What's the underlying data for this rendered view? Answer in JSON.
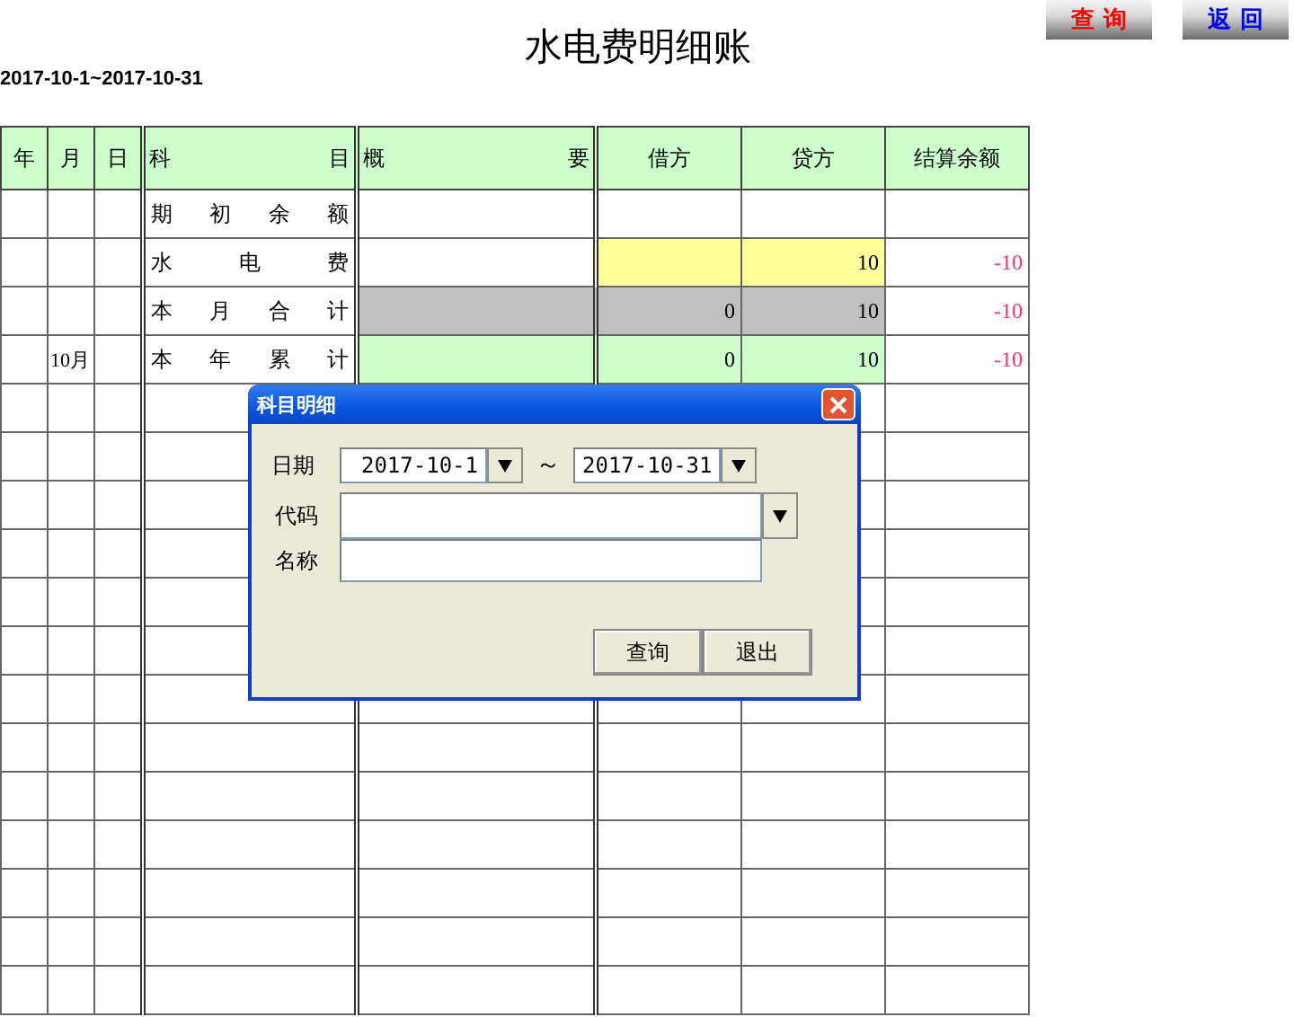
{
  "title": "水电费明细账",
  "period": "2017-10-1~2017-10-31",
  "top_buttons": [
    {
      "label": "查 询",
      "kind": "query"
    },
    {
      "label": "返 回",
      "kind": "back"
    }
  ],
  "table": {
    "columns": [
      "年",
      "月",
      "日",
      "科 目",
      "概 要",
      "借方",
      "贷方",
      "结算余额"
    ],
    "rows": [
      {
        "kind": "opening",
        "year": "",
        "month": "",
        "day": "",
        "subject": "期 初 余 额",
        "summary": "",
        "debit": "",
        "credit": "",
        "balance": ""
      },
      {
        "kind": "item",
        "year": "",
        "month": "",
        "day": "",
        "subject": "水 电 费",
        "summary": "",
        "debit": "",
        "credit": "10",
        "balance": "-10"
      },
      {
        "kind": "month_total",
        "year": "",
        "month": "",
        "day": "",
        "subject": "本 月 合 计",
        "summary": "",
        "debit": "0",
        "credit": "10",
        "balance": "-10"
      },
      {
        "kind": "year_total",
        "year": "",
        "month": "10月",
        "day": "",
        "subject": "本 年 累 计",
        "summary": "",
        "debit": "0",
        "credit": "10",
        "balance": "-10"
      }
    ]
  },
  "dialog": {
    "title": "科目明细",
    "date_label": "日期",
    "date_from": "2017-10-1",
    "separator": "～",
    "date_to": "2017-10-31",
    "code_label": "代码",
    "name_label": "名称",
    "buttons": [
      "查询",
      "退出"
    ]
  }
}
